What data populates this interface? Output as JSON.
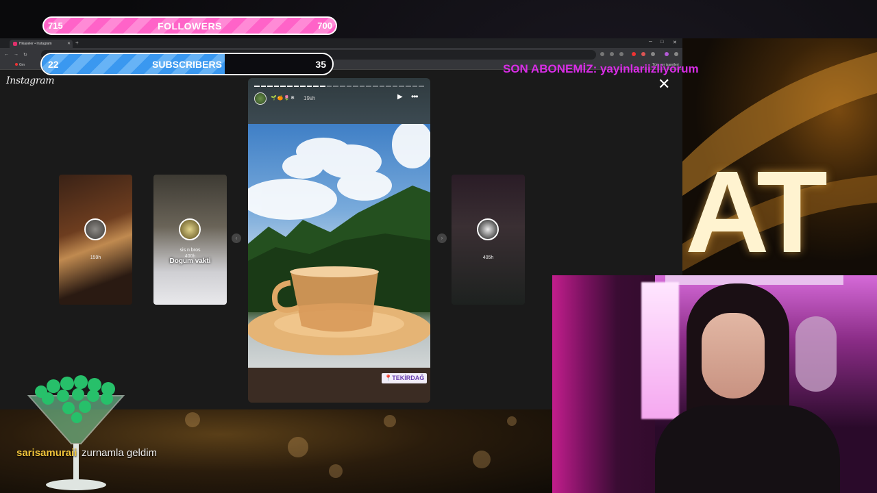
{
  "browser": {
    "tab_title": "Hikayeler • Instagram",
    "new_tab": "+",
    "close_tab": "✕",
    "window_controls": [
      "─",
      "□",
      "✕"
    ],
    "bookmarks": [
      "Gm",
      "Tüm yer işaretleri"
    ]
  },
  "instagram": {
    "logo": "Instagram",
    "close": "✕",
    "side_stories": [
      {
        "time": "159h"
      },
      {
        "name": "sis n bros",
        "time": "400h",
        "caption": "Dogum vakti"
      },
      {
        "time": "405h"
      }
    ],
    "main_story": {
      "emojis": "🌱🍊🌷❄",
      "time": "19sh",
      "location": "📍TEKİRDAĞ",
      "progress_segments": 26,
      "progress_done": 11
    },
    "prev_arrow": "‹",
    "next_arrow": "›"
  },
  "overlay": {
    "followers": {
      "label": "FOLLOWERS",
      "current": "715",
      "goal": "700",
      "progress": 1.0
    },
    "subscribers": {
      "label": "SUBSCRIBERS",
      "current": "22",
      "goal": "35",
      "progress": 0.629
    },
    "last_sub": "SON ABONEMİZ: yayinlariizliyorum",
    "big_letters": "AT",
    "chat": {
      "user": "sarisamuraii",
      "message": "zurnamla geldim"
    }
  },
  "colors": {
    "followers_pink": "#ff63c8",
    "subscribers_blue": "#3a98f0",
    "last_sub_magenta": "#d92de6",
    "chat_user_gold": "#f0c33a"
  }
}
